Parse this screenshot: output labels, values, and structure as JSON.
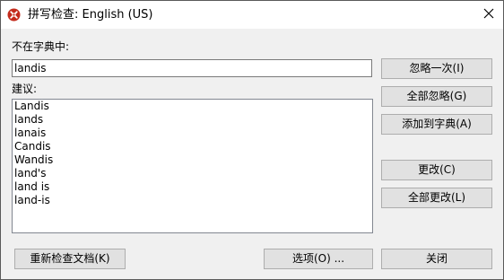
{
  "window": {
    "title": "拼写检查:  English (US)"
  },
  "not_in_dictionary": {
    "label": "不在字典中:",
    "value": "landis"
  },
  "suggestions": {
    "label": "建议:",
    "items": [
      "Landis",
      "lands",
      "lanais",
      "Candis",
      "Wandis",
      "land's",
      "land is",
      "land-is"
    ]
  },
  "buttons": {
    "ignore_once": "忽略一次(I)",
    "ignore_all": "全部忽略(G)",
    "add_to_dictionary": "添加到字典(A)",
    "change": "更改(C)",
    "change_all": "全部更改(L)",
    "recheck_document": "重新检查文档(K)",
    "options": "选项(O) ...",
    "close": "关闭"
  },
  "icons": {
    "app": "spellcheck-app-icon",
    "close": "close-icon"
  },
  "colors": {
    "app_icon": "#c42b1c",
    "title_bar": "#ffffff",
    "dialog_bg": "#f0f0f0",
    "button_bg": "#e1e1e1"
  }
}
